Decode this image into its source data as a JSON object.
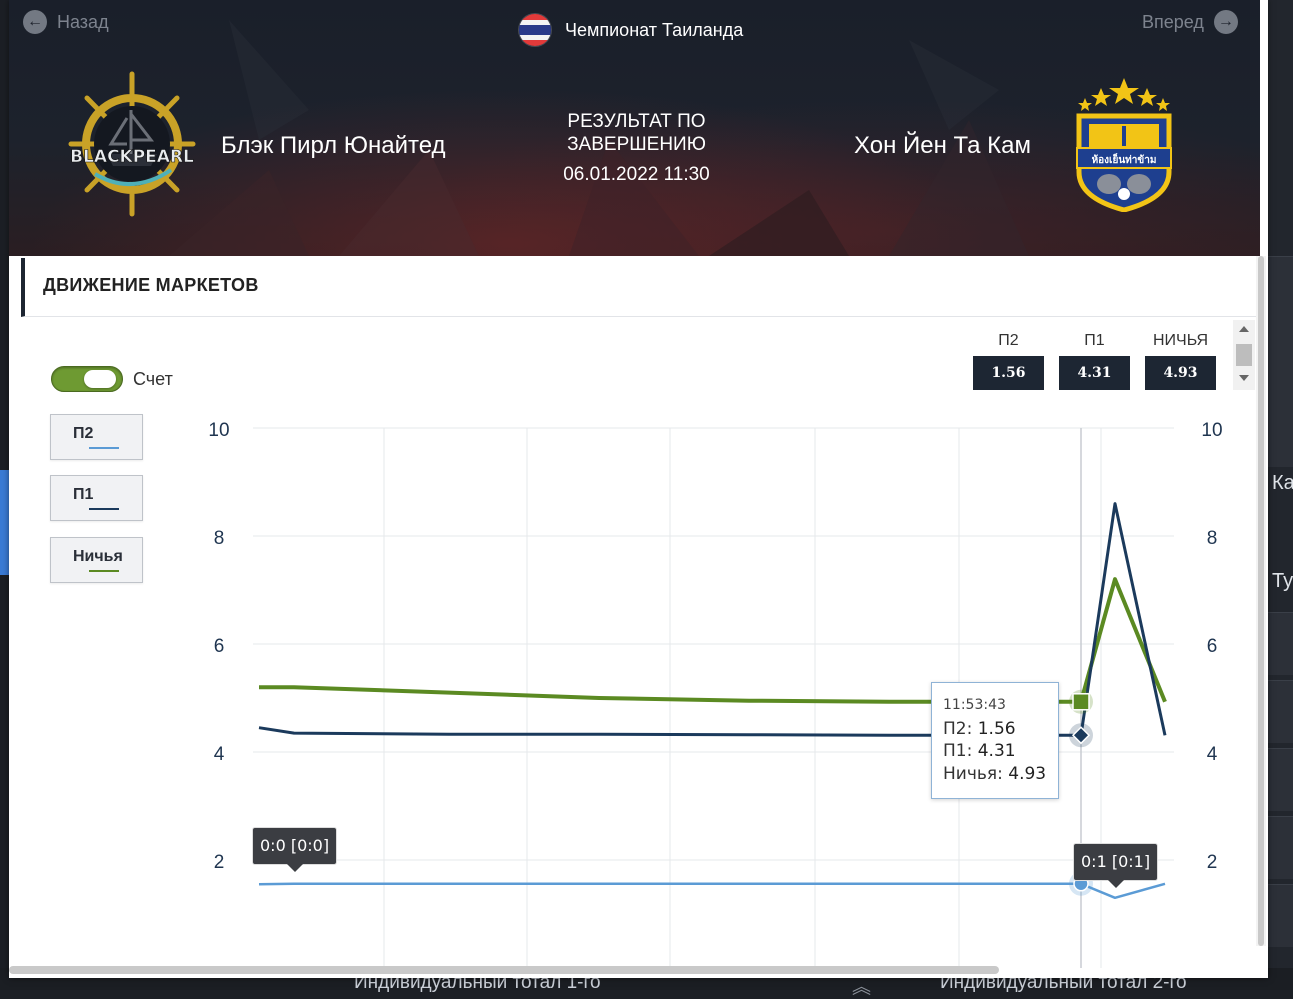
{
  "nav": {
    "back": "Назад",
    "forward": "Вперед"
  },
  "league": "Чемпионат Таиланда",
  "home_team": "Блэк Пирл Юнайтед",
  "away_team": "Хон Йен Та Кам",
  "home_logo_text": "BLACKPEARL",
  "away_logo_text": "ห้องเย็นท่าข้าม",
  "result": {
    "line1": "РЕЗУЛЬТАТ ПО",
    "line2": "ЗАВЕРШЕНИЮ",
    "date": "06.01.2022 11:30"
  },
  "section_title": "ДВИЖЕНИЕ МАРКЕТОВ",
  "toggle_label": "Счет",
  "legend": [
    {
      "label": "П2",
      "color": "#5b9bd5"
    },
    {
      "label": "П1",
      "color": "#1b3a5c"
    },
    {
      "label": "Ничья",
      "color": "#5b8a22"
    }
  ],
  "odds": [
    {
      "label": "П2",
      "value": "1.56"
    },
    {
      "label": "П1",
      "value": "4.31"
    },
    {
      "label": "НИЧЬЯ",
      "value": "4.93"
    }
  ],
  "tooltip": {
    "time": "11:53:43",
    "p2_label": "П2:",
    "p2_value": "1.56",
    "p1_label": "П1:",
    "p1_value": "4.31",
    "draw_label": "Ничья:",
    "draw_value": "4.93"
  },
  "score_markers": [
    "0:0 [0:0]",
    "0:1 [0:1]"
  ],
  "background": {
    "right_text_1": "Ка",
    "right_text_2": "Ту",
    "bottom_text_1": "Индивидуальный тотал 1-го",
    "bottom_text_2": "Индивидуальный тотал 2-го"
  },
  "chart_data": {
    "type": "line",
    "y_ticks_left": [
      "10",
      "8",
      "6",
      "4",
      "2"
    ],
    "y_ticks_right": [
      "10",
      "8",
      "6",
      "4",
      "2"
    ],
    "ylim": [
      0,
      10
    ],
    "x": [
      0,
      1,
      2,
      3,
      4,
      5,
      6,
      7,
      8,
      9,
      10
    ],
    "series": [
      {
        "name": "Ничья",
        "color": "#5b8a22",
        "values": [
          5.2,
          5.2,
          5.1,
          5.0,
          4.95,
          4.93,
          4.93,
          4.93,
          7.2,
          4.93,
          null
        ]
      },
      {
        "name": "П1",
        "color": "#1b3a5c",
        "values": [
          4.45,
          4.35,
          4.33,
          4.33,
          4.32,
          4.31,
          4.31,
          4.31,
          8.6,
          4.31,
          null
        ]
      },
      {
        "name": "П2",
        "color": "#5b9bd5",
        "values": [
          1.55,
          1.56,
          1.56,
          1.56,
          1.56,
          1.56,
          1.56,
          1.56,
          1.3,
          1.56,
          null
        ]
      }
    ]
  }
}
